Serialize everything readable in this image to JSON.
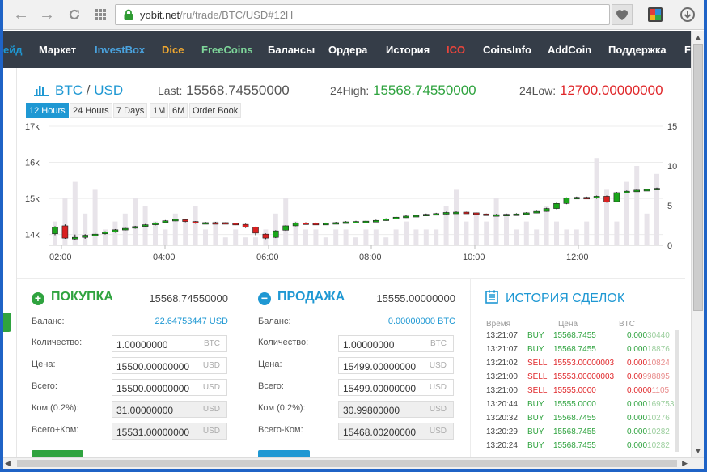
{
  "browser": {
    "url_domain": "yobit.net",
    "url_path": "/ru/trade/BTC/USD#12H"
  },
  "nav": {
    "items": [
      {
        "label": "ейд",
        "color": "#1f98d3"
      },
      {
        "label": "Маркет",
        "color": "#ffffff"
      },
      {
        "label": "InvestBox",
        "color": "#4aa3df"
      },
      {
        "label": "Dice",
        "color": "#f0a830"
      },
      {
        "label": "FreeCoins",
        "color": "#7ed69a"
      },
      {
        "label": "Балансы",
        "color": "#ffffff"
      },
      {
        "label": "Ордера",
        "color": "#ffffff"
      },
      {
        "label": "История",
        "color": "#ffffff"
      },
      {
        "label": "ICO",
        "color": "#e8453c"
      },
      {
        "label": "CoinsInfo",
        "color": "#ffffff"
      },
      {
        "label": "AddCoin",
        "color": "#ffffff"
      },
      {
        "label": "Поддержка",
        "color": "#ffffff"
      },
      {
        "label": "F",
        "color": "#ffffff"
      }
    ]
  },
  "ticker": {
    "base": "BTC",
    "slash": "/",
    "quote": "USD",
    "last_label": "Last:",
    "last": "15568.74550000",
    "high_label": "24High:",
    "high": "15568.74550000",
    "low_label": "24Low:",
    "low": "12700.00000000"
  },
  "ranges": [
    "12 Hours",
    "24 Hours",
    "7 Days",
    "1M",
    "6M",
    "Order Book"
  ],
  "chart_data": {
    "type": "candlestick",
    "x_ticks": [
      "02:00",
      "04:00",
      "06:00",
      "08:00",
      "10:00",
      "12:00"
    ],
    "y_left_ticks": [
      "14k",
      "15k",
      "16k",
      "17k"
    ],
    "y_right_ticks": [
      "0",
      "5",
      "10",
      "15"
    ],
    "ylim": [
      13700,
      17000
    ],
    "volume_lim": [
      0,
      15
    ],
    "grid": true,
    "colors": {
      "up": "#1aa61a",
      "down": "#d92020",
      "volume": "#e8e4ea"
    },
    "candles": [
      [
        14020,
        14200,
        13980,
        14230
      ],
      [
        14240,
        13900,
        13880,
        14280
      ],
      [
        13900,
        13920,
        13850,
        14000
      ],
      [
        13920,
        13980,
        13880,
        14010
      ],
      [
        13990,
        14010,
        13960,
        14050
      ],
      [
        14020,
        14070,
        14000,
        14090
      ],
      [
        14070,
        14130,
        14050,
        14150
      ],
      [
        14130,
        14170,
        14110,
        14190
      ],
      [
        14180,
        14220,
        14160,
        14240
      ],
      [
        14230,
        14270,
        14210,
        14290
      ],
      [
        14270,
        14320,
        14250,
        14340
      ],
      [
        14330,
        14380,
        14310,
        14400
      ],
      [
        14390,
        14420,
        14370,
        14440
      ],
      [
        14410,
        14360,
        14340,
        14430
      ],
      [
        14360,
        14330,
        14300,
        14370
      ],
      [
        14320,
        14330,
        14300,
        14350
      ],
      [
        14330,
        14320,
        14300,
        14350
      ],
      [
        14330,
        14310,
        14290,
        14340
      ],
      [
        14310,
        14280,
        14260,
        14320
      ],
      [
        14280,
        14200,
        14180,
        14300
      ],
      [
        14200,
        14040,
        13980,
        14220
      ],
      [
        14010,
        13900,
        13870,
        14030
      ],
      [
        13920,
        14100,
        13900,
        14120
      ],
      [
        14120,
        14240,
        14100,
        14260
      ],
      [
        14240,
        14320,
        14230,
        14340
      ],
      [
        14320,
        14310,
        14290,
        14340
      ],
      [
        14310,
        14300,
        14280,
        14330
      ],
      [
        14300,
        14310,
        14290,
        14330
      ],
      [
        14310,
        14330,
        14300,
        14350
      ],
      [
        14330,
        14350,
        14320,
        14370
      ],
      [
        14350,
        14360,
        14330,
        14380
      ],
      [
        14360,
        14370,
        14340,
        14390
      ],
      [
        14370,
        14390,
        14360,
        14410
      ],
      [
        14390,
        14430,
        14380,
        14450
      ],
      [
        14430,
        14480,
        14420,
        14500
      ],
      [
        14480,
        14510,
        14460,
        14530
      ],
      [
        14510,
        14530,
        14500,
        14550
      ],
      [
        14530,
        14560,
        14510,
        14580
      ],
      [
        14560,
        14580,
        14540,
        14600
      ],
      [
        14580,
        14610,
        14560,
        14630
      ],
      [
        14610,
        14620,
        14590,
        14640
      ],
      [
        14620,
        14600,
        14580,
        14630
      ],
      [
        14600,
        14570,
        14550,
        14610
      ],
      [
        14570,
        14540,
        14520,
        14580
      ],
      [
        14540,
        14550,
        14520,
        14570
      ],
      [
        14550,
        14560,
        14530,
        14580
      ],
      [
        14560,
        14570,
        14540,
        14590
      ],
      [
        14570,
        14600,
        14560,
        14620
      ],
      [
        14600,
        14640,
        14590,
        14660
      ],
      [
        14640,
        14720,
        14630,
        14740
      ],
      [
        14720,
        14860,
        14700,
        14880
      ],
      [
        14860,
        15010,
        14840,
        15030
      ],
      [
        15010,
        15030,
        14980,
        15050
      ],
      [
        15030,
        15010,
        14990,
        15050
      ],
      [
        15010,
        15060,
        14990,
        15080
      ],
      [
        15060,
        14900,
        14880,
        15080
      ],
      [
        14910,
        15160,
        14900,
        15180
      ],
      [
        15160,
        15200,
        15140,
        15220
      ],
      [
        15200,
        15230,
        15180,
        15250
      ],
      [
        15230,
        15250,
        15210,
        15270
      ],
      [
        15250,
        15280,
        15230,
        15300
      ]
    ],
    "volumes": [
      3,
      6,
      8,
      4,
      7,
      2,
      3,
      4,
      6,
      5,
      3,
      2,
      4,
      3,
      5,
      2,
      3,
      1,
      2,
      1,
      1,
      2,
      4,
      6,
      3,
      2,
      2,
      1,
      2,
      2,
      1,
      2,
      2,
      1,
      2,
      3,
      2,
      2,
      2,
      5,
      7,
      3,
      4,
      3,
      6,
      4,
      2,
      3,
      2,
      5,
      3,
      2,
      2,
      3,
      11,
      7,
      3,
      8,
      10,
      4,
      9
    ]
  },
  "buy": {
    "title": "ПОКУПКА",
    "price": "15568.74550000",
    "balance_label": "Баланс:",
    "balance": "22.64753447 USD",
    "fields": [
      {
        "label": "Количество:",
        "value": "1.00000000",
        "unit": "BTC"
      },
      {
        "label": "Цена:",
        "value": "15500.00000000",
        "unit": "USD"
      },
      {
        "label": "Всего:",
        "value": "15500.00000000",
        "unit": "USD"
      },
      {
        "label": "Ком (0.2%):",
        "value": "31.00000000",
        "unit": "USD"
      },
      {
        "label": "Всего+Ком:",
        "value": "15531.00000000",
        "unit": "USD"
      }
    ]
  },
  "sell": {
    "title": "ПРОДАЖА",
    "price": "15555.00000000",
    "balance_label": "Баланс:",
    "balance": "0.00000000 BTC",
    "fields": [
      {
        "label": "Количество:",
        "value": "1.00000000",
        "unit": "BTC"
      },
      {
        "label": "Цена:",
        "value": "15499.00000000",
        "unit": "USD"
      },
      {
        "label": "Всего:",
        "value": "15499.00000000",
        "unit": "USD"
      },
      {
        "label": "Ком (0.2%):",
        "value": "30.99800000",
        "unit": "USD"
      },
      {
        "label": "Всего-Ком:",
        "value": "15468.00200000",
        "unit": "USD"
      }
    ]
  },
  "history": {
    "title": "ИСТОРИЯ СДЕЛОК",
    "col_time": "Время",
    "col_price": "Цена",
    "col_amount": "BTC",
    "rows": [
      {
        "time": "13:21:07",
        "type": "BUY",
        "price": "15568.7455",
        "amount_dim": "0.000",
        "amount": "30440"
      },
      {
        "time": "13:21:07",
        "type": "BUY",
        "price": "15568.7455",
        "amount_dim": "0.000",
        "amount": "18876"
      },
      {
        "time": "13:21:02",
        "type": "SELL",
        "price": "15553.00000003",
        "amount_dim": "0.000",
        "amount": "10824"
      },
      {
        "time": "13:21:00",
        "type": "SELL",
        "price": "15553.00000003",
        "amount_dim": "0.00",
        "amount": "998895"
      },
      {
        "time": "13:21:00",
        "type": "SELL",
        "price": "15555.0000",
        "amount_dim": "0.0000",
        "amount": "1105"
      },
      {
        "time": "13:20:44",
        "type": "BUY",
        "price": "15555.0000",
        "amount_dim": "0.000",
        "amount": "169753"
      },
      {
        "time": "13:20:32",
        "type": "BUY",
        "price": "15568.7455",
        "amount_dim": "0.000",
        "amount": "10276"
      },
      {
        "time": "13:20:29",
        "type": "BUY",
        "price": "15568.7455",
        "amount_dim": "0.000",
        "amount": "10282"
      },
      {
        "time": "13:20:24",
        "type": "BUY",
        "price": "15568.7455",
        "amount_dim": "0.000",
        "amount": "10282"
      }
    ]
  },
  "colors": {
    "buy_green": "#2fa33f",
    "sell_blue": "#1f98d3",
    "sell_red": "#e0282b",
    "nav_bg": "#353d48"
  }
}
